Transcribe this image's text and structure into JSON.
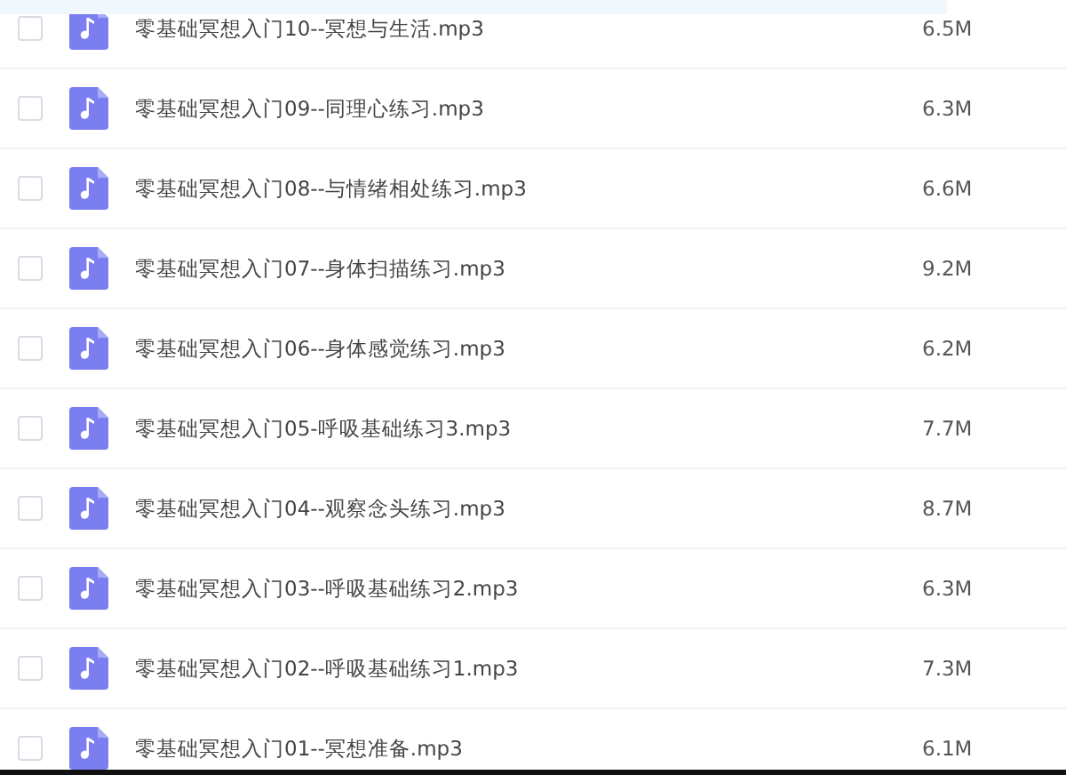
{
  "files": [
    {
      "name": "零基础冥想入门10--冥想与生活.mp3",
      "size": "6.5M",
      "checked": false
    },
    {
      "name": "零基础冥想入门09--同理心练习.mp3",
      "size": "6.3M",
      "checked": false
    },
    {
      "name": "零基础冥想入门08--与情绪相处练习.mp3",
      "size": "6.6M",
      "checked": false
    },
    {
      "name": "零基础冥想入门07--身体扫描练习.mp3",
      "size": "9.2M",
      "checked": false
    },
    {
      "name": "零基础冥想入门06--身体感觉练习.mp3",
      "size": "6.2M",
      "checked": false
    },
    {
      "name": "零基础冥想入门05-呼吸基础练习3.mp3",
      "size": "7.7M",
      "checked": false
    },
    {
      "name": "零基础冥想入门04--观察念头练习.mp3",
      "size": "8.7M",
      "checked": false
    },
    {
      "name": "零基础冥想入门03--呼吸基础练习2.mp3",
      "size": "6.3M",
      "checked": false
    },
    {
      "name": "零基础冥想入门02--呼吸基础练习1.mp3",
      "size": "7.3M",
      "checked": false
    },
    {
      "name": "零基础冥想入门01--冥想准备.mp3",
      "size": "6.1M",
      "checked": false
    }
  ]
}
